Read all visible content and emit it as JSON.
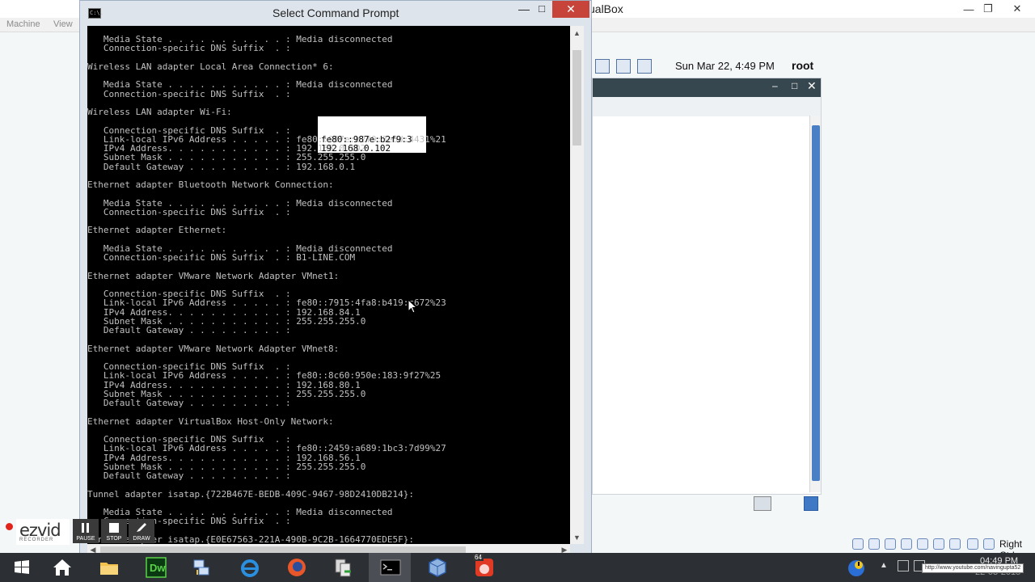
{
  "vbox": {
    "title": "ualBox",
    "menu": {
      "machine": "Machine",
      "view": "View"
    },
    "guest": {
      "clock": "Sun Mar 22,  4:49 PM",
      "user": "root"
    },
    "status": {
      "host_key": "Right Ctrl"
    }
  },
  "cmd": {
    "title": "Select Command Prompt",
    "icon_text": "C:\\.",
    "selection_lines": [
      "fe80::987e:b2f9:3",
      "192.168.0.102"
    ],
    "lines": [
      "   Media State . . . . . . . . . . . : Media disconnected",
      "   Connection-specific DNS Suffix  . :",
      "",
      "Wireless LAN adapter Local Area Connection* 6:",
      "",
      "   Media State . . . . . . . . . . . : Media disconnected",
      "   Connection-specific DNS Suffix  . :",
      "",
      "Wireless LAN adapter Wi-Fi:",
      "",
      "   Connection-specific DNS Suffix  . :",
      "   Link-local IPv6 Address . . . . . : fe80::987e:b2f9:3e6d:4431%21",
      "   IPv4 Address. . . . . . . . . . . : 192.168.0.102",
      "   Subnet Mask . . . . . . . . . . . : 255.255.255.0",
      "   Default Gateway . . . . . . . . . : 192.168.0.1",
      "",
      "Ethernet adapter Bluetooth Network Connection:",
      "",
      "   Media State . . . . . . . . . . . : Media disconnected",
      "   Connection-specific DNS Suffix  . :",
      "",
      "Ethernet adapter Ethernet:",
      "",
      "   Media State . . . . . . . . . . . : Media disconnected",
      "   Connection-specific DNS Suffix  . : B1-LINE.COM",
      "",
      "Ethernet adapter VMware Network Adapter VMnet1:",
      "",
      "   Connection-specific DNS Suffix  . :",
      "   Link-local IPv6 Address . . . . . : fe80::7915:4fa8:b419:c672%23",
      "   IPv4 Address. . . . . . . . . . . : 192.168.84.1",
      "   Subnet Mask . . . . . . . . . . . : 255.255.255.0",
      "   Default Gateway . . . . . . . . . :",
      "",
      "Ethernet adapter VMware Network Adapter VMnet8:",
      "",
      "   Connection-specific DNS Suffix  . :",
      "   Link-local IPv6 Address . . . . . : fe80::8c60:950e:183:9f27%25",
      "   IPv4 Address. . . . . . . . . . . : 192.168.80.1",
      "   Subnet Mask . . . . . . . . . . . : 255.255.255.0",
      "   Default Gateway . . . . . . . . . :",
      "",
      "Ethernet adapter VirtualBox Host-Only Network:",
      "",
      "   Connection-specific DNS Suffix  . :",
      "   Link-local IPv6 Address . . . . . : fe80::2459:a689:1bc3:7d99%27",
      "   IPv4 Address. . . . . . . . . . . : 192.168.56.1",
      "   Subnet Mask . . . . . . . . . . . : 255.255.255.0",
      "   Default Gateway . . . . . . . . . :",
      "",
      "Tunnel adapter isatap.{722B467E-BEDB-409C-9467-98D2410DB214}:",
      "",
      "   Media State . . . . . . . . . . . : Media disconnected",
      "   Connection-specific DNS Suffix  . :",
      "",
      "Tunnel adapter isatap.{E0E67563-221A-490B-9C2B-1664770EDE5F}:"
    ]
  },
  "ezvid": {
    "name": "ezvid",
    "sub": "RECORDER",
    "buttons": {
      "pause": "PAUSE",
      "stop": "STOP",
      "draw": "DRAW"
    }
  },
  "taskbar": {
    "items": [
      "start",
      "file-explorer",
      "dreamweaver",
      "network-tool",
      "internet-explorer",
      "firefox",
      "file-manager",
      "command-prompt",
      "virtualbox",
      "recorder"
    ],
    "active": "command-prompt",
    "icon_labels": {
      "dreamweaver": "Dw",
      "recorder_badge": "64"
    },
    "clock": {
      "time": "04:49 PM",
      "date": "22-03-2015"
    },
    "tooltip_url": "http://www.youtube.com/navingupta52"
  },
  "colors": {
    "console_bg": "#000000",
    "console_fg": "#c0c0c0",
    "close_red": "#c7443a",
    "taskbar_bg": "#2c2f33"
  }
}
